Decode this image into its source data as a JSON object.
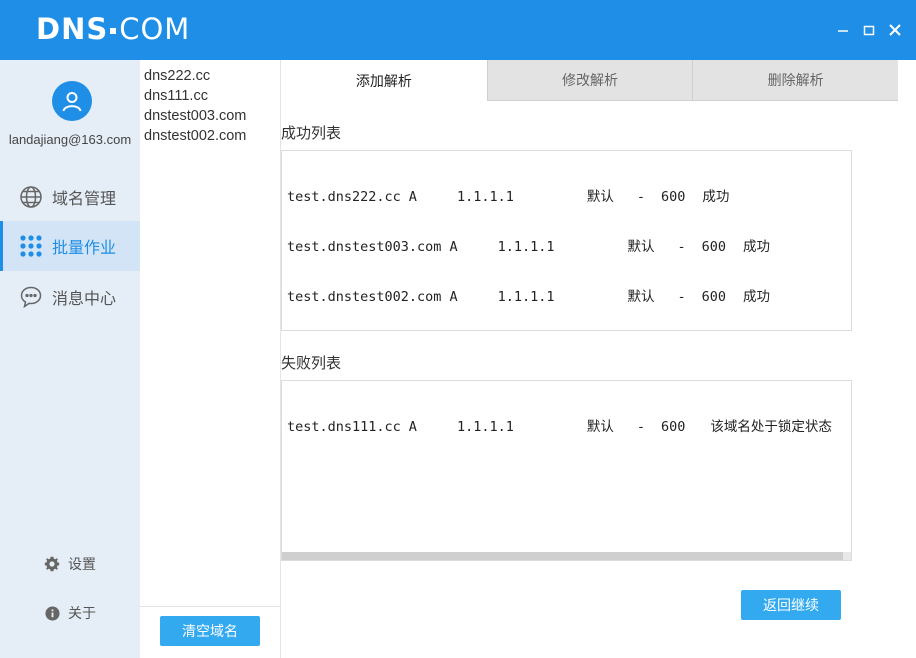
{
  "app": {
    "logo_bold": "DNS",
    "logo_light": "COM"
  },
  "sidebar": {
    "user_email": "landajiang@163.com",
    "nav": [
      {
        "label": "域名管理",
        "icon": "globe-icon"
      },
      {
        "label": "批量作业",
        "icon": "grid-dots-icon"
      },
      {
        "label": "消息中心",
        "icon": "chat-bubble-icon"
      }
    ],
    "settings_label": "设置",
    "about_label": "关于"
  },
  "domains": {
    "items": [
      "dns222.cc",
      "dns111.cc",
      "dnstest003.com",
      "dnstest002.com"
    ],
    "clear_label": "清空域名"
  },
  "tabs": [
    {
      "label": "添加解析",
      "active": true
    },
    {
      "label": "修改解析",
      "active": false
    },
    {
      "label": "删除解析",
      "active": false
    }
  ],
  "success": {
    "title": "成功列表",
    "rows": [
      {
        "host": "test.dns222.cc",
        "type": "A",
        "value": "1.1.1.1",
        "line": "默认",
        "mx": "-",
        "ttl": "600",
        "status": "成功"
      },
      {
        "host": "test.dnstest003.com",
        "type": "A",
        "value": "1.1.1.1",
        "line": "默认",
        "mx": "-",
        "ttl": "600",
        "status": "成功"
      },
      {
        "host": "test.dnstest002.com",
        "type": "A",
        "value": "1.1.1.1",
        "line": "默认",
        "mx": "-",
        "ttl": "600",
        "status": "成功"
      }
    ]
  },
  "failure": {
    "title": "失败列表",
    "rows": [
      {
        "host": "test.dns111.cc",
        "type": "A",
        "value": "1.1.1.1",
        "line": "默认",
        "mx": "-",
        "ttl": "600",
        "status": "该域名处于锁定状态"
      }
    ]
  },
  "actions": {
    "return_label": "返回继续"
  },
  "colors": {
    "brand": "#1e8ee6",
    "button": "#33aaf0",
    "sidebar_bg": "#e5eef7"
  }
}
